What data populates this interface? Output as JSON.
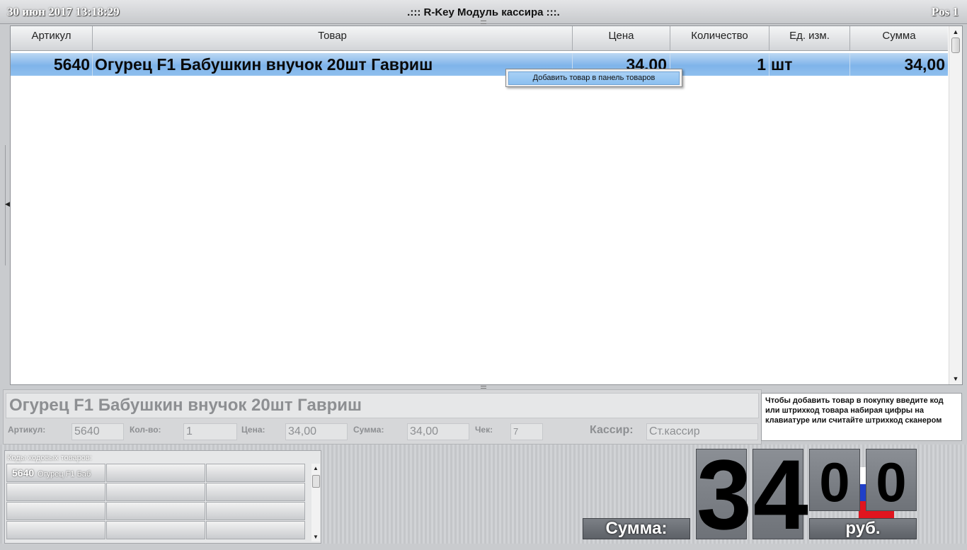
{
  "header": {
    "datetime": "30 июн 2017 13:18:29",
    "title": ".::: R-Key Модуль кассира :::.",
    "pos": "Pos 1"
  },
  "table": {
    "columns": [
      "Артикул",
      "Товар",
      "Цена",
      "Количество",
      "Ед. изм.",
      "Сумма"
    ],
    "rows": [
      {
        "article": "5640",
        "product": "Огурец F1 Бабушкин внучок 20шт Гавриш",
        "price": "34,00",
        "qty": "1",
        "unit": "шт",
        "sum": "34,00"
      }
    ]
  },
  "context_menu": {
    "item": "Добавить товар в панель товаров"
  },
  "info": {
    "product_name": "Огурец F1 Бабушкин внучок 20шт Гавриш",
    "article_label": "Артикул:",
    "article_value": "5640",
    "qty_label": "Кол-во:",
    "qty_value": "1",
    "price_label": "Цена:",
    "price_value": "34,00",
    "sum_label": "Сумма:",
    "sum_value": "34,00",
    "check_label": "Чек:",
    "check_value": "7",
    "cashier_label": "Кассир:",
    "cashier_value": "Ст.кассир"
  },
  "hint": "Чтобы добавить товар в покупку введите код или штрихкод товара набирая цифры на клавиатуре или считайте штрихкод сканером",
  "quick_items": {
    "label": "Коды ходовых товаров:",
    "items": [
      {
        "code": "5640",
        "name": "Огурец F1 Баб"
      }
    ]
  },
  "total": {
    "label": "Сумма:",
    "digits": [
      "3",
      "4",
      "0",
      "0"
    ],
    "currency": "руб."
  },
  "colors": {
    "selected_row": "#8fbfee",
    "flag_white": "#ffffff",
    "flag_blue": "#1f3fc8",
    "flag_red": "#e0151f"
  }
}
